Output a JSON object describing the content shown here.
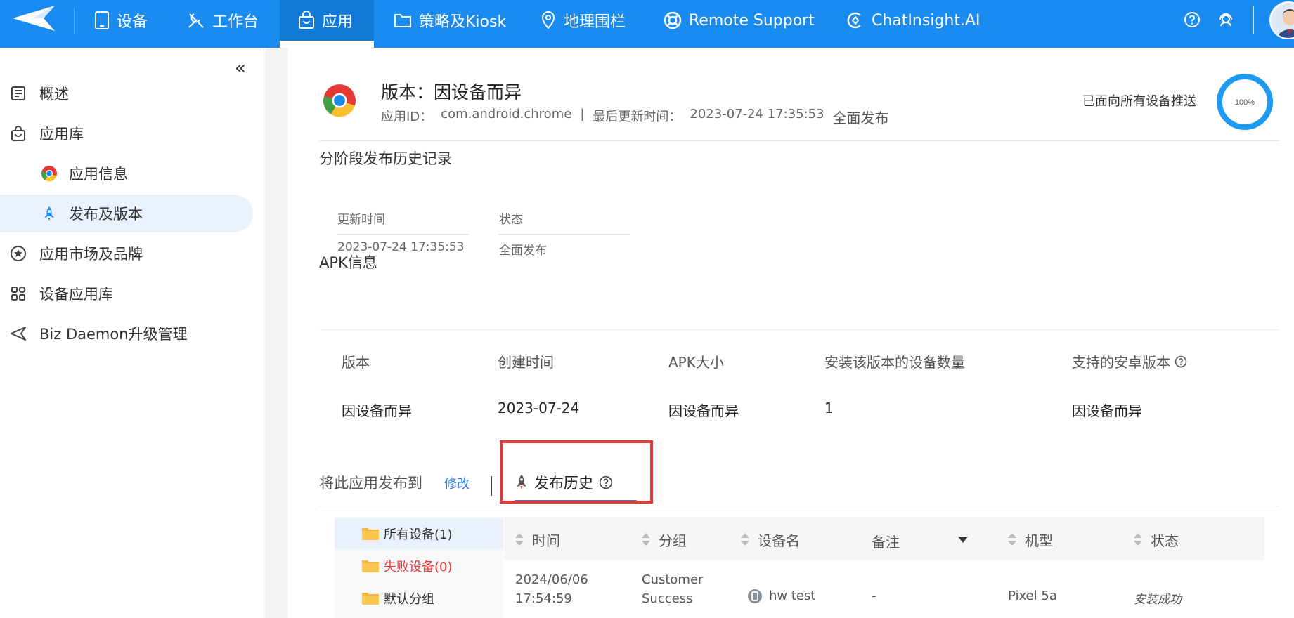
{
  "topnav": {
    "items": [
      {
        "icon": "tablet-icon",
        "label": "设备"
      },
      {
        "icon": "tools-icon",
        "label": "工作台"
      },
      {
        "icon": "bag-icon",
        "label": "应用"
      },
      {
        "icon": "folder-icon",
        "label": "策略及Kiosk"
      },
      {
        "icon": "map-pin-icon",
        "label": "地理围栏"
      },
      {
        "icon": "lifebuoy-icon",
        "label": "Remote Support"
      },
      {
        "icon": "chat-ai-icon",
        "label": "ChatInsight.AI"
      }
    ],
    "active_index": 2,
    "accent_color": "#1a8bf0"
  },
  "sidebar": {
    "items": [
      {
        "label": "概述",
        "icon": "list-icon"
      },
      {
        "label": "应用库",
        "icon": "bag-icon"
      },
      {
        "label": "应用信息",
        "icon": "chrome-icon"
      },
      {
        "label": "发布及版本",
        "icon": "rocket-icon"
      },
      {
        "label": "应用市场及品牌",
        "icon": "star-circle-icon"
      },
      {
        "label": "设备应用库",
        "icon": "grid-icon"
      },
      {
        "label": "Biz Daemon升级管理",
        "icon": "send-icon"
      }
    ],
    "active_index": 3
  },
  "app": {
    "title": "版本：因设备而异",
    "id_label": "应用ID：",
    "id_value": "com.android.chrome",
    "separator": "|",
    "updated_label": "最后更新时间：",
    "updated_value": "2023-07-24 17:35:53",
    "publish_mode": "全面发布",
    "push_status": "已面向所有设备推送",
    "progress_label": "100%",
    "progress": 1.0
  },
  "history": {
    "title": "分阶段发布历史记录",
    "headers": [
      "更新时间",
      "状态"
    ],
    "rows": [
      [
        "2023-07-24 17:35:53",
        "全面发布"
      ]
    ]
  },
  "apk": {
    "title": "APK信息",
    "headers": [
      "版本",
      "创建时间",
      "APK大小",
      "安装该版本的设备数量",
      "支持的安卓版本"
    ],
    "values": [
      "因设备而异",
      "2023-07-24",
      "因设备而异",
      "1",
      "因设备而异"
    ]
  },
  "publish": {
    "label": "将此应用发布到",
    "edit": "修改",
    "tab_history": "发布历史"
  },
  "folders": {
    "items": [
      "所有设备(1)",
      "失败设备(0)",
      "默认分组"
    ]
  },
  "table": {
    "headers": [
      "时间",
      "分组",
      "设备名",
      "备注",
      "机型",
      "状态"
    ],
    "rows": [
      {
        "time_date": "2024/06/06",
        "time_clock": "17:54:59",
        "group_line1": "Customer",
        "group_line2": "Success",
        "device": "hw test",
        "note": "-",
        "model": "Pixel 5a",
        "status": "安装成功"
      }
    ]
  }
}
